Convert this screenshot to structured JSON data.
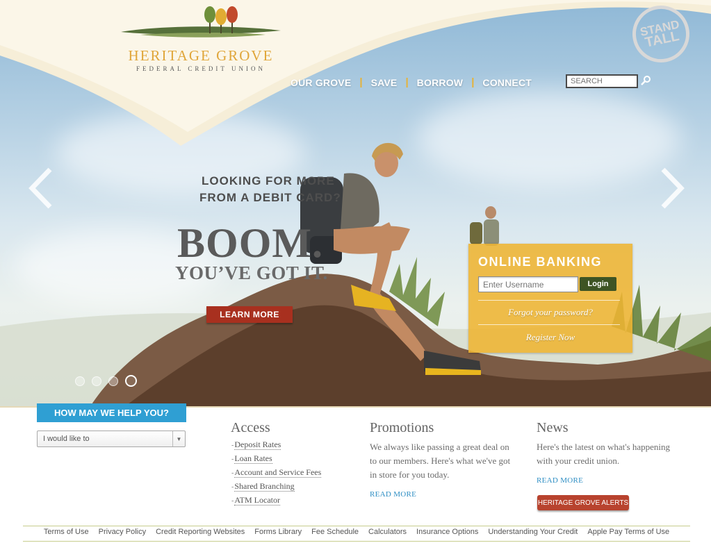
{
  "brand": {
    "name": "HERITAGE GROVE",
    "tagline": "FEDERAL CREDIT UNION",
    "badge_line1": "STAND",
    "badge_line2": "TALL"
  },
  "nav": {
    "items": [
      "OUR GROVE",
      "SAVE",
      "BORROW",
      "CONNECT"
    ],
    "search_placeholder": "SEARCH"
  },
  "hero": {
    "kicker_line1": "LOOKING FOR MORE",
    "kicker_line2": "FROM A DEBIT CARD?",
    "headline": "BOOM.",
    "subheadline": "YOU’VE GOT IT.",
    "cta": "LEARN MORE",
    "slides_count": 4,
    "active_slide": 4
  },
  "online_banking": {
    "title": "ONLINE BANKING",
    "username_placeholder": "Enter Username",
    "login_label": "Login",
    "forgot_label": "Forgot your password?",
    "register_label": "Register Now"
  },
  "help": {
    "button_label": "HOW MAY WE HELP YOU?",
    "select_value": "I would like to"
  },
  "access": {
    "title": "Access",
    "links": [
      "Deposit Rates",
      "Loan Rates",
      "Account and Service Fees",
      "Shared Branching",
      "ATM Locator"
    ]
  },
  "promotions": {
    "title": "Promotions",
    "text": "We always like passing a great deal on to our members. Here's what we've got in store for you today.",
    "read_more": "READ MORE"
  },
  "news": {
    "title": "News",
    "text": "Here's the latest on what's happening with your credit union.",
    "read_more": "READ MORE",
    "alerts_button": "HERITAGE GROVE ALERTS"
  },
  "footer": {
    "links": [
      "Terms of Use",
      "Privacy Policy",
      "Credit Reporting Websites",
      "Forms Library",
      "Fee Schedule",
      "Calculators",
      "Insurance Options",
      "Understanding Your Credit",
      "Apple Pay Terms of Use"
    ]
  },
  "colors": {
    "gold": "#e0a63a",
    "blue": "#2f9fd3",
    "red": "#a8301f",
    "green": "#3e5424"
  }
}
